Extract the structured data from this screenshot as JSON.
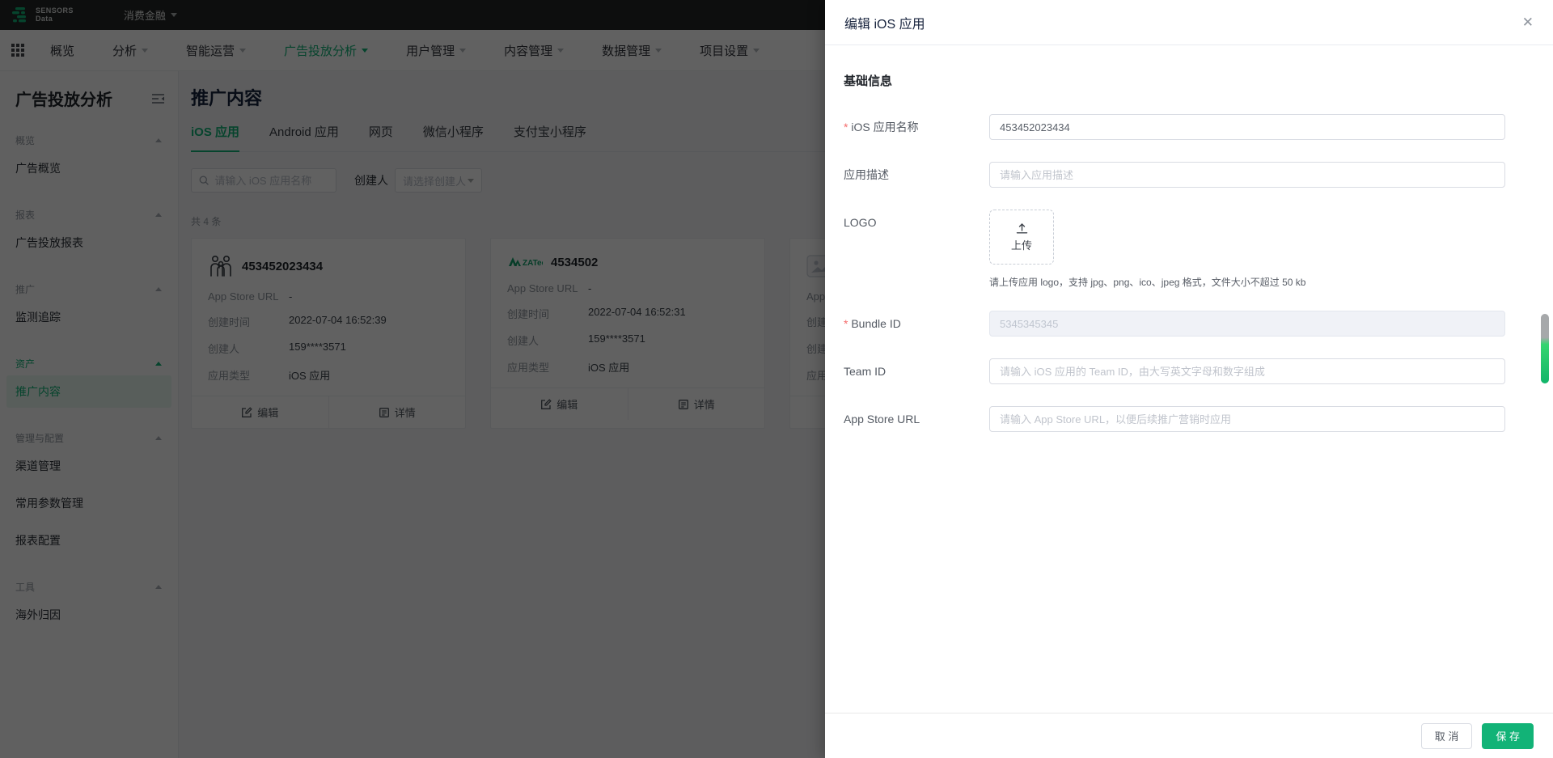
{
  "colors": {
    "accent": "#12b377",
    "accent_light_bg": "#e7f6ee",
    "danger": "#f56c6c",
    "topbar_bg": "#222625"
  },
  "topbar": {
    "brand_top": "SENSORS",
    "brand_bottom": "Data",
    "project": "消费金融"
  },
  "navbar": {
    "items": [
      {
        "label": "概览"
      },
      {
        "label": "分析"
      },
      {
        "label": "智能运营"
      },
      {
        "label": "广告投放分析"
      },
      {
        "label": "用户管理"
      },
      {
        "label": "内容管理"
      },
      {
        "label": "数据管理"
      },
      {
        "label": "项目设置"
      }
    ]
  },
  "sidebar": {
    "title": "广告投放分析",
    "groups": [
      {
        "label": "概览",
        "items": [
          {
            "label": "广告概览"
          }
        ]
      },
      {
        "label": "报表",
        "items": [
          {
            "label": "广告投放报表"
          }
        ]
      },
      {
        "label": "推广",
        "items": [
          {
            "label": "监测追踪"
          }
        ]
      },
      {
        "label": "资产",
        "items": [
          {
            "label": "推广内容"
          }
        ]
      },
      {
        "label": "管理与配置",
        "items": [
          {
            "label": "渠道管理"
          },
          {
            "label": "常用参数管理"
          },
          {
            "label": "报表配置"
          }
        ]
      },
      {
        "label": "工具",
        "items": [
          {
            "label": "海外归因"
          }
        ]
      }
    ]
  },
  "main": {
    "title": "推广内容",
    "tabs": [
      {
        "label": "iOS 应用"
      },
      {
        "label": "Android 应用"
      },
      {
        "label": "网页"
      },
      {
        "label": "微信小程序"
      },
      {
        "label": "支付宝小程序"
      }
    ],
    "search_placeholder": "请输入 iOS 应用名称",
    "creator_filter_label": "创建人",
    "creator_filter_placeholder": "请选择创建人",
    "count_text": "共 4 条",
    "card_field_labels": [
      "App Store URL",
      "创建时间",
      "创建人",
      "应用类型"
    ],
    "card_actions": {
      "edit": "编辑",
      "detail": "详情"
    },
    "cards": [
      {
        "name": "453452023434",
        "icon": "family-logo",
        "values": [
          "-",
          "2022-07-04 16:52:39",
          "159****3571",
          "iOS 应用"
        ]
      },
      {
        "name": "4534502",
        "icon": "zatech-logo",
        "values": [
          "-",
          "2022-07-04 16:52:31",
          "159****3571",
          "iOS 应用"
        ]
      },
      {
        "name": "",
        "icon": "image-placeholder",
        "values": [
          "",
          "",
          "",
          ""
        ]
      }
    ]
  },
  "drawer": {
    "title": "编辑 iOS 应用",
    "close_icon": "✕",
    "section_title": "基础信息",
    "fields": {
      "ios_name": {
        "label": "iOS 应用名称",
        "value": "453452023434"
      },
      "app_desc": {
        "label": "应用描述",
        "placeholder": "请输入应用描述"
      },
      "logo": {
        "label": "LOGO",
        "upload_text": "上传",
        "help": "请上传应用 logo，支持 jpg、png、ico、jpeg 格式，文件大小不超过 50 kb"
      },
      "bundle_id": {
        "label": "Bundle ID",
        "value": "5345345345"
      },
      "team_id": {
        "label": "Team ID",
        "placeholder": "请输入 iOS 应用的 Team ID，由大写英文字母和数字组成"
      },
      "app_store_url": {
        "label": "App Store URL",
        "placeholder": "请输入 App Store URL，以便后续推广营销时应用"
      }
    },
    "cancel_label": "取 消",
    "save_label": "保 存"
  }
}
